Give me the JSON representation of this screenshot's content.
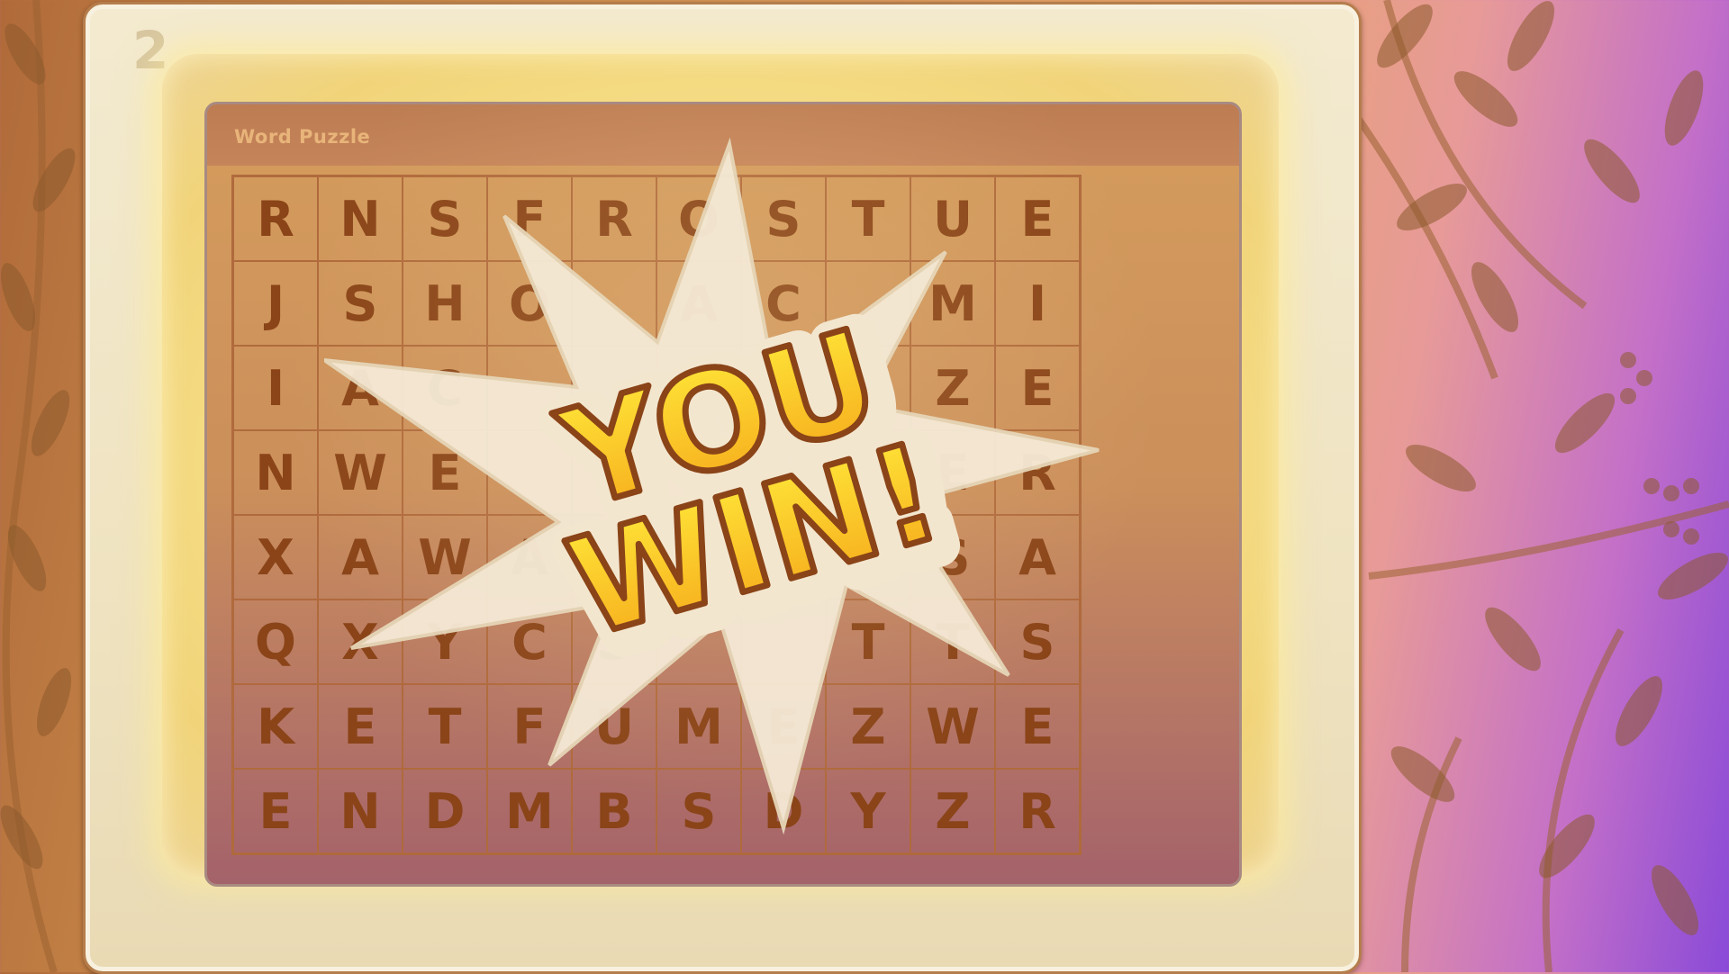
{
  "device": {
    "number": "2"
  },
  "window": {
    "title": "Word Puzzle"
  },
  "grid": {
    "rows": [
      [
        "R",
        "N",
        "S",
        "F",
        "R",
        "O",
        "S",
        "T",
        "U",
        "E"
      ],
      [
        "J",
        "S",
        "H",
        "O",
        "",
        "A",
        "C",
        "",
        "M",
        "I"
      ],
      [
        "I",
        "A",
        "C",
        "",
        "",
        "",
        "",
        "",
        "Z",
        "E"
      ],
      [
        "N",
        "W",
        "E",
        "",
        "",
        "",
        "",
        "",
        "E",
        "R"
      ],
      [
        "X",
        "A",
        "W",
        "A",
        "",
        "",
        "",
        "",
        "S",
        "A"
      ],
      [
        "Q",
        "X",
        "Y",
        "C",
        "S",
        "",
        "",
        "T",
        "T",
        "S"
      ],
      [
        "K",
        "E",
        "T",
        "F",
        "U",
        "M",
        "E",
        "Z",
        "W",
        "E"
      ],
      [
        "E",
        "N",
        "D",
        "M",
        "B",
        "S",
        "D",
        "Y",
        "Z",
        "R"
      ]
    ]
  },
  "win_banner": {
    "line1": "YOU",
    "line2": "WIN!"
  },
  "colors": {
    "letter": "#8a4418",
    "win_text_top": "#ffe93a",
    "win_text_bottom": "#f6a81a",
    "win_outline": "#8a4418",
    "burst": "#f5ead6"
  }
}
